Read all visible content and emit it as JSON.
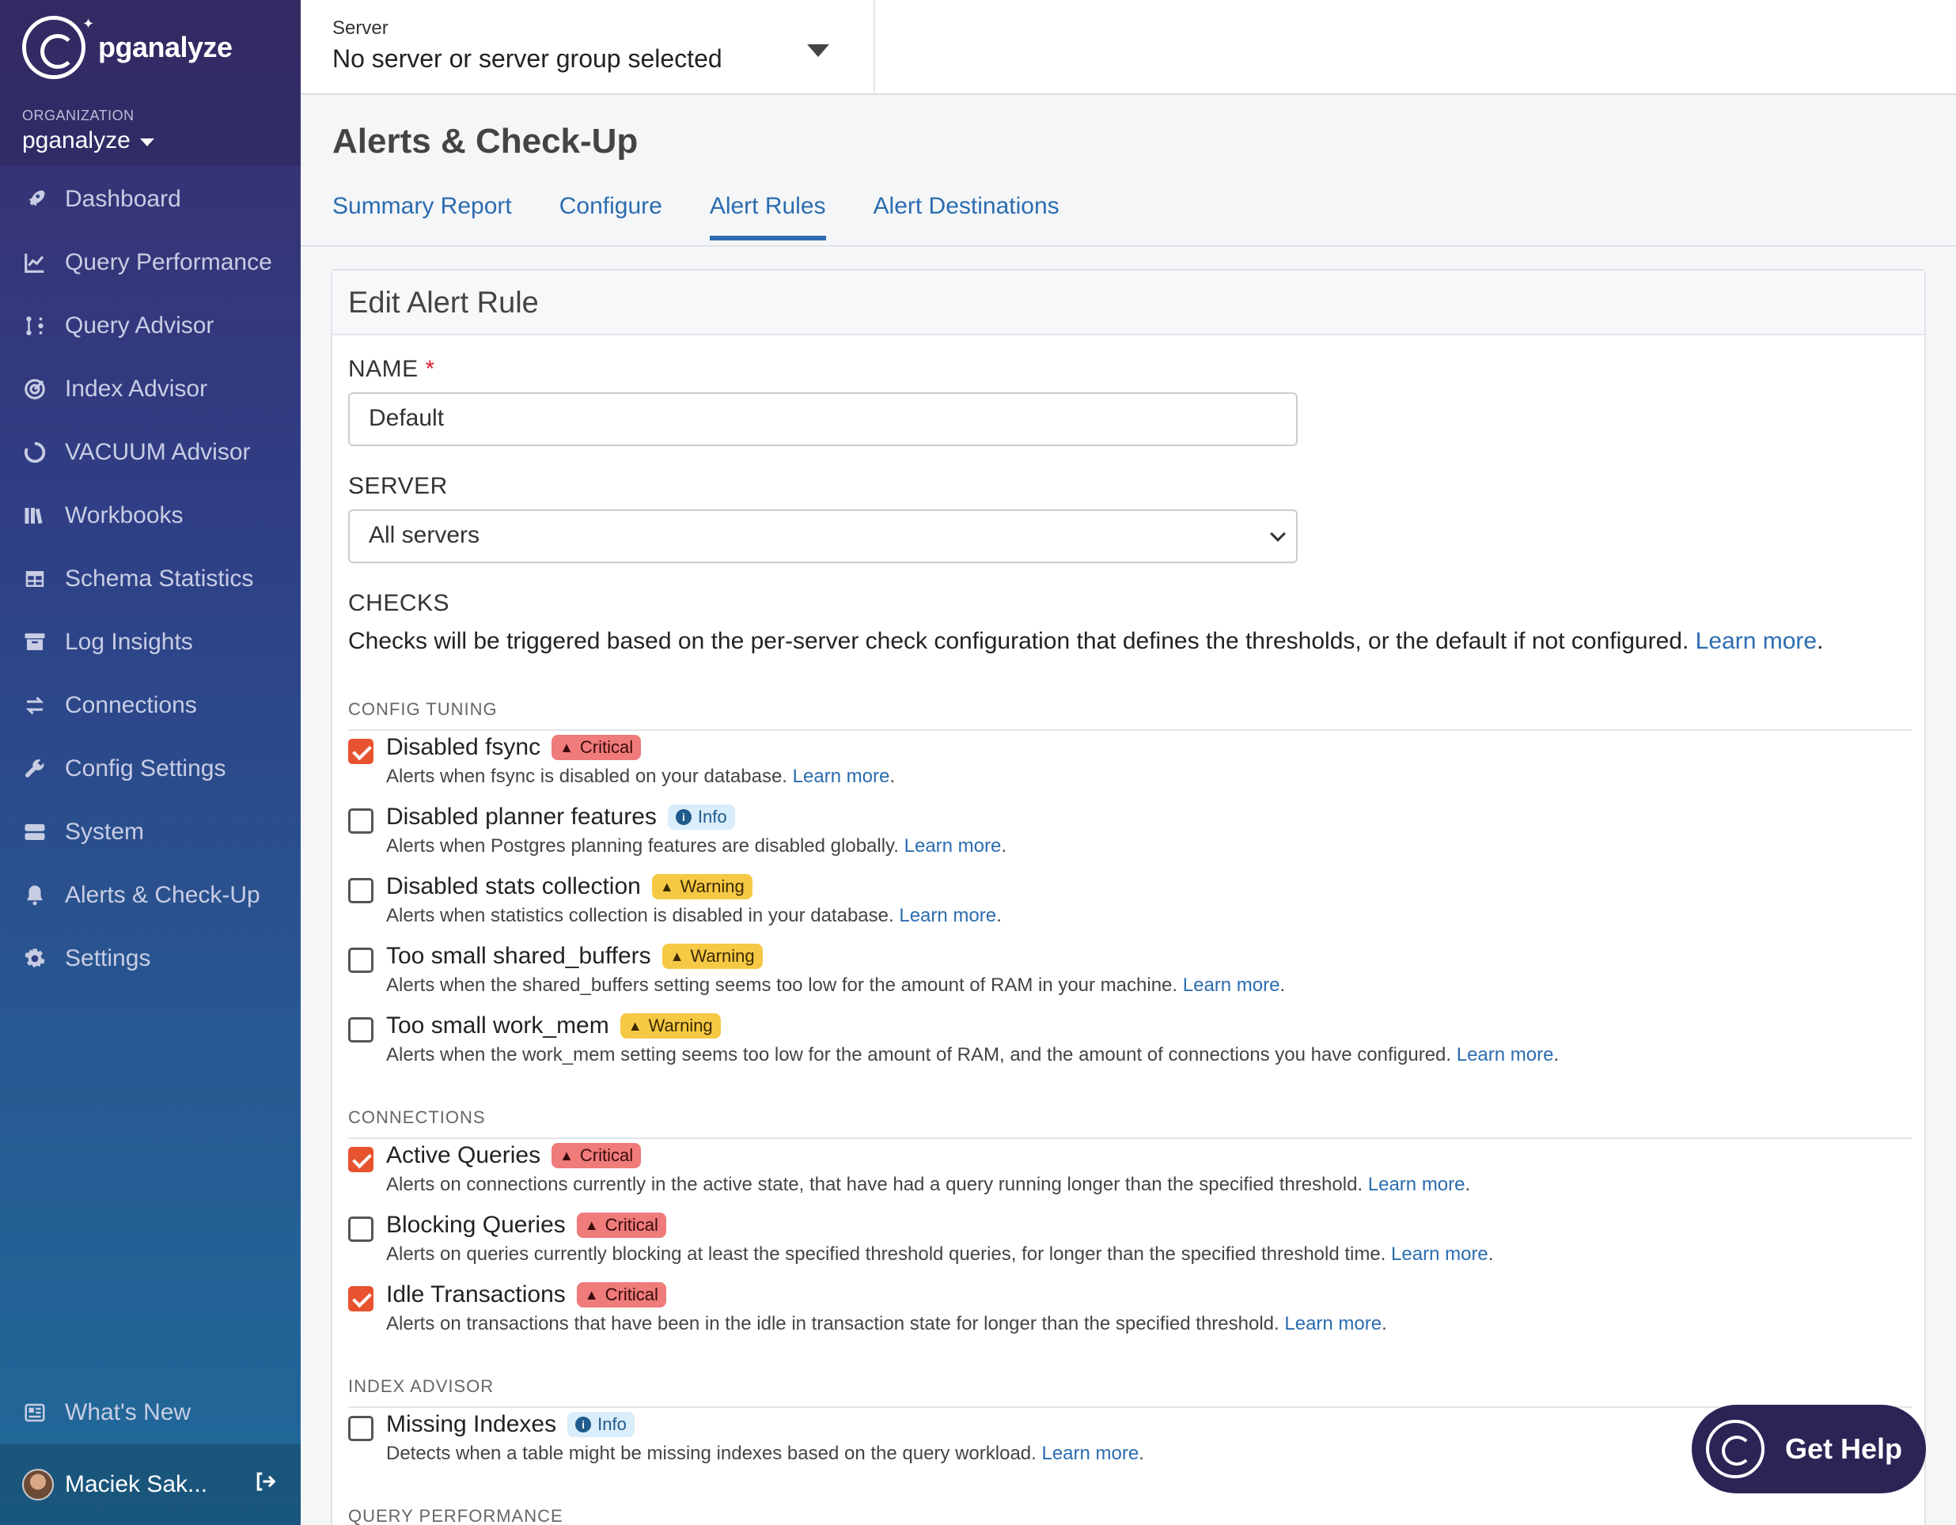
{
  "sidebar": {
    "brand": "pganalyze",
    "org_label": "ORGANIZATION",
    "org_name": "pganalyze",
    "items": [
      {
        "label": "Dashboard",
        "icon": "rocket-icon"
      },
      {
        "label": "Query Performance",
        "icon": "chart-line-icon"
      },
      {
        "label": "Query Advisor",
        "icon": "advisor-icon"
      },
      {
        "label": "Index Advisor",
        "icon": "target-icon"
      },
      {
        "label": "VACUUM Advisor",
        "icon": "circle-icon"
      },
      {
        "label": "Workbooks",
        "icon": "books-icon"
      },
      {
        "label": "Schema Statistics",
        "icon": "table-icon"
      },
      {
        "label": "Log Insights",
        "icon": "archive-icon"
      },
      {
        "label": "Connections",
        "icon": "exchange-icon"
      },
      {
        "label": "Config Settings",
        "icon": "wrench-icon"
      },
      {
        "label": "System",
        "icon": "server-icon"
      },
      {
        "label": "Alerts & Check-Up",
        "icon": "bell-icon"
      },
      {
        "label": "Settings",
        "icon": "gear-icon"
      }
    ],
    "whats_new": "What's New",
    "user_name": "Maciek Sak..."
  },
  "topbar": {
    "server_label": "Server",
    "server_value": "No server or server group selected"
  },
  "page": {
    "title": "Alerts & Check-Up",
    "tabs": [
      "Summary Report",
      "Configure",
      "Alert Rules",
      "Alert Destinations"
    ],
    "active_tab": "Alert Rules"
  },
  "form": {
    "card_title": "Edit Alert Rule",
    "name_label": "NAME",
    "name_required": "*",
    "name_value": "Default",
    "server_label": "SERVER",
    "server_value": "All servers",
    "checks_label": "CHECKS",
    "checks_desc": "Checks will be triggered based on the per-server check configuration that defines the thresholds, or the default if not configured.",
    "learn_more": "Learn more"
  },
  "sections": [
    {
      "title": "CONFIG TUNING",
      "checks": [
        {
          "name": "Disabled fsync",
          "severity": "Critical",
          "checked": true,
          "desc": "Alerts when fsync is disabled on your database."
        },
        {
          "name": "Disabled planner features",
          "severity": "Info",
          "checked": false,
          "desc": "Alerts when Postgres planning features are disabled globally."
        },
        {
          "name": "Disabled stats collection",
          "severity": "Warning",
          "checked": false,
          "desc": "Alerts when statistics collection is disabled in your database."
        },
        {
          "name": "Too small shared_buffers",
          "severity": "Warning",
          "checked": false,
          "desc": "Alerts when the shared_buffers setting seems too low for the amount of RAM in your machine."
        },
        {
          "name": "Too small work_mem",
          "severity": "Warning",
          "checked": false,
          "desc": "Alerts when the work_mem setting seems too low for the amount of RAM, and the amount of connections you have configured."
        }
      ]
    },
    {
      "title": "CONNECTIONS",
      "checks": [
        {
          "name": "Active Queries",
          "severity": "Critical",
          "checked": true,
          "desc": "Alerts on connections currently in the active state, that have had a query running longer than the specified threshold."
        },
        {
          "name": "Blocking Queries",
          "severity": "Critical",
          "checked": false,
          "desc": "Alerts on queries currently blocking at least the specified threshold queries, for longer than the specified threshold time."
        },
        {
          "name": "Idle Transactions",
          "severity": "Critical",
          "checked": true,
          "desc": "Alerts on transactions that have been in the idle in transaction state for longer than the specified threshold."
        }
      ]
    },
    {
      "title": "INDEX ADVISOR",
      "checks": [
        {
          "name": "Missing Indexes",
          "severity": "Info",
          "checked": false,
          "desc": "Detects when a table might be missing indexes based on the query workload."
        }
      ]
    },
    {
      "title": "QUERY PERFORMANCE",
      "checks": []
    }
  ],
  "get_help": "Get Help",
  "colors": {
    "accent": "#2b6cb0",
    "checkbox_checked": "#e8532f",
    "critical": "#f07b7b",
    "warning": "#f6c945",
    "info": "#d9edfa"
  }
}
